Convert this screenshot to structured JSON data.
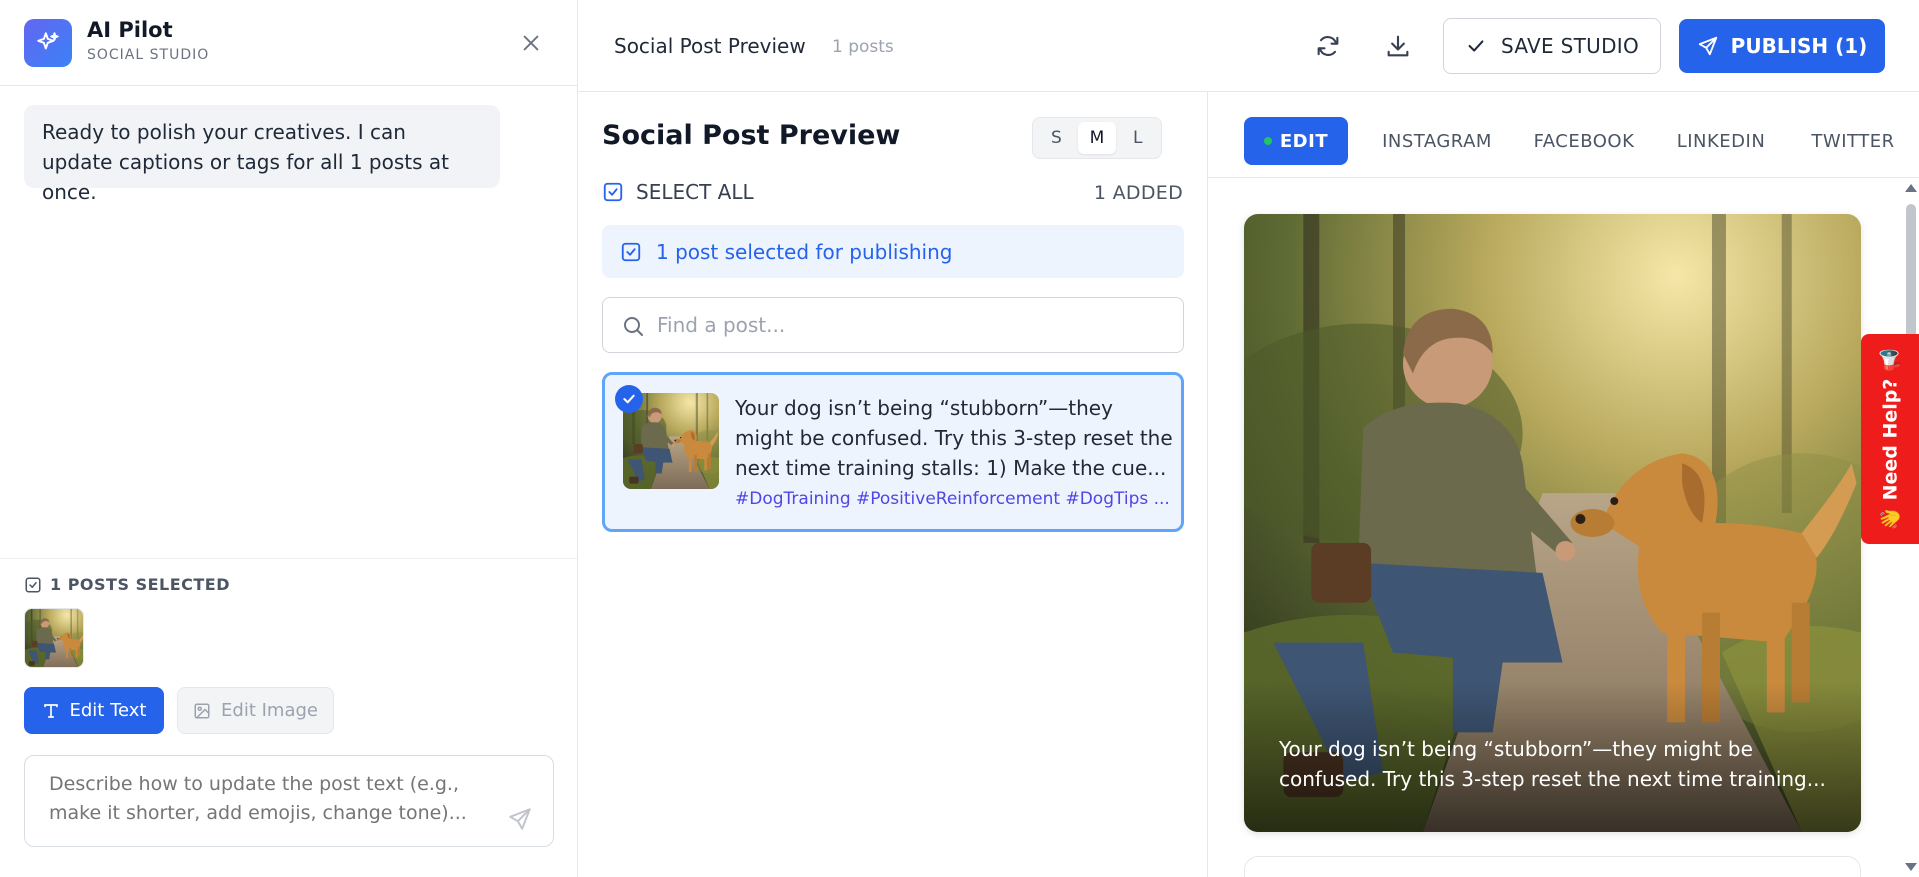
{
  "sidebar": {
    "app_name": "AI Pilot",
    "app_subtitle": "SOCIAL STUDIO",
    "message": "Ready to polish your creatives. I can update captions or tags for all 1 posts at once.",
    "selected_label": "1 POSTS SELECTED",
    "edit_text_label": "Edit Text",
    "edit_image_label": "Edit Image",
    "prompt_placeholder": "Describe how to update the post text (e.g., make it shorter, add emojis, change tone)..."
  },
  "topbar": {
    "title": "Social Post Preview",
    "count": "1 posts",
    "save_label": "SAVE STUDIO",
    "publish_label": "PUBLISH (1)"
  },
  "main": {
    "title": "Social Post Preview",
    "sizes": [
      "S",
      "M",
      "L"
    ],
    "active_size": "M",
    "select_all_label": "SELECT ALL",
    "added_label": "1 ADDED",
    "banner": "1 post selected for publishing",
    "search_placeholder": "Find a post...",
    "posts": [
      {
        "text": "Your dog isn’t being “stubborn”—they might be confused. Try this 3-step reset the next time training stalls: 1) Make the cue...",
        "tags": "#DogTraining #PositiveReinforcement #DogTips ..."
      }
    ]
  },
  "preview": {
    "tabs": [
      "EDIT",
      "INSTAGRAM",
      "FACEBOOK",
      "LINKEDIN",
      "TWITTER"
    ],
    "active_tab": "EDIT",
    "caption": "Your dog isn’t being “stubborn”—they might be confused. Try this 3-step reset the next time training..."
  },
  "help_tab": {
    "label": "👋 Need Help? 📢"
  },
  "colors": {
    "accent": "#2563eb",
    "accent_light": "#eef4fd",
    "help": "#ef1c1c",
    "tag": "#4f46e5"
  }
}
